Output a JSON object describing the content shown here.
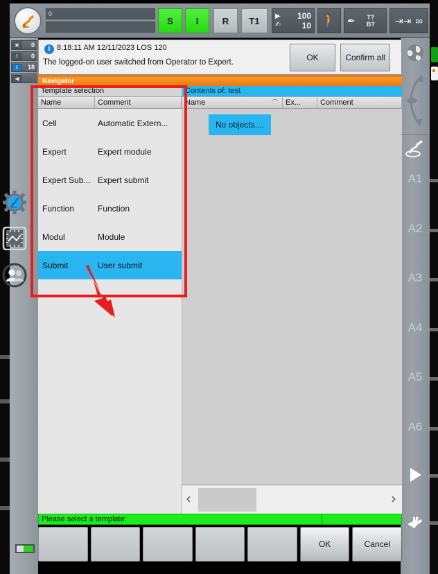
{
  "topbar": {
    "logo_icon": "kuka-robot-icon",
    "state_value": "0",
    "state_value2": "",
    "buttons": [
      {
        "id": "submit-interpreter",
        "label": "S",
        "style": "green"
      },
      {
        "id": "drives-interpreter",
        "label": "I",
        "style": "green"
      },
      {
        "id": "robot-interpreter",
        "label": "R",
        "style": "grey"
      },
      {
        "id": "operating-mode",
        "label": "T1",
        "style": "grey"
      },
      {
        "id": "walk-mode",
        "label": "walk-icon",
        "style": "dark"
      },
      {
        "id": "tool-base",
        "label": "T?B?",
        "style": "dark"
      },
      {
        "id": "incremental-jog",
        "label": "∞",
        "style": "dark"
      }
    ],
    "override": {
      "program_pct": "100",
      "jog_pct": "10",
      "program_icon": "play-icon",
      "jog_icon": "hand-icon"
    },
    "tool_label": "T?",
    "base_label": "B?",
    "increment_icon": "increment-icon",
    "increment_value": "∞"
  },
  "counters": [
    {
      "icon": "ack-message-icon",
      "count": "0"
    },
    {
      "icon": "warning-message-icon",
      "count": "0"
    },
    {
      "icon": "info-message-icon",
      "count": "18",
      "highlight": true
    }
  ],
  "message": {
    "icon": "info-icon",
    "timestamp": "8:18:11 AM 12/11/2023 LOS 120",
    "text": "The logged-on user switched from Operator to Expert.",
    "ok_label": "OK",
    "confirm_all_label": "Confirm all"
  },
  "navigator": {
    "title": "Navigator",
    "left_pane": {
      "header": "Template selection",
      "columns": [
        "Name",
        "Comment"
      ],
      "rows": [
        {
          "name": "Cell",
          "comment": "Automatic Extern...",
          "selected": false
        },
        {
          "name": "Expert",
          "comment": "Expert module",
          "selected": false
        },
        {
          "name": "Expert Sub...",
          "comment": "Expert submit",
          "selected": false
        },
        {
          "name": "Function",
          "comment": "Function",
          "selected": false
        },
        {
          "name": "Modul",
          "comment": "Module",
          "selected": false
        },
        {
          "name": "Submit",
          "comment": "User submit",
          "selected": true
        }
      ]
    },
    "right_pane": {
      "header": "Contents of: test",
      "columns": [
        "Name",
        "Ex...",
        "Comment"
      ],
      "sort_indicator": "sort-ascending-icon",
      "empty_label": "No objects....",
      "scroll_left_icon": "chevron-left-icon",
      "scroll_right_icon": "chevron-right-icon"
    }
  },
  "status": {
    "prompt": "Please select a template:"
  },
  "softkeys": [
    {
      "label": "",
      "strong": false
    },
    {
      "label": "",
      "strong": false
    },
    {
      "label": "",
      "strong": false
    },
    {
      "label": "",
      "strong": false
    },
    {
      "label": "",
      "strong": false
    },
    {
      "label": "OK",
      "strong": true
    },
    {
      "label": "Cancel",
      "strong": true
    }
  ],
  "sidebar_left": {
    "icons": [
      {
        "name": "configuration-gear-icon"
      },
      {
        "name": "display-keypad-icon"
      },
      {
        "name": "user-group-icon"
      }
    ],
    "battery_icon": "battery-icon"
  },
  "sidebar_right": {
    "top_icons": [
      {
        "name": "world-coordinates-icon"
      },
      {
        "name": "jog-direction-icon"
      }
    ],
    "robot_icon": "robot-axis-icon",
    "axes": [
      "A1",
      "A2",
      "A3",
      "A4",
      "A5",
      "A6"
    ],
    "play_icon": "play-triangle-icon",
    "hand_icon": "hand-jog-icon"
  },
  "annotation": {
    "highlight_color": "#e81e1e",
    "arrow_icon": "pointer-arrow-icon",
    "target": "Submit"
  },
  "colors": {
    "accent_orange": "#ef7d11",
    "selection_blue": "#29b6f0",
    "status_green": "#1aef1a",
    "ok_green": "#27d814"
  }
}
